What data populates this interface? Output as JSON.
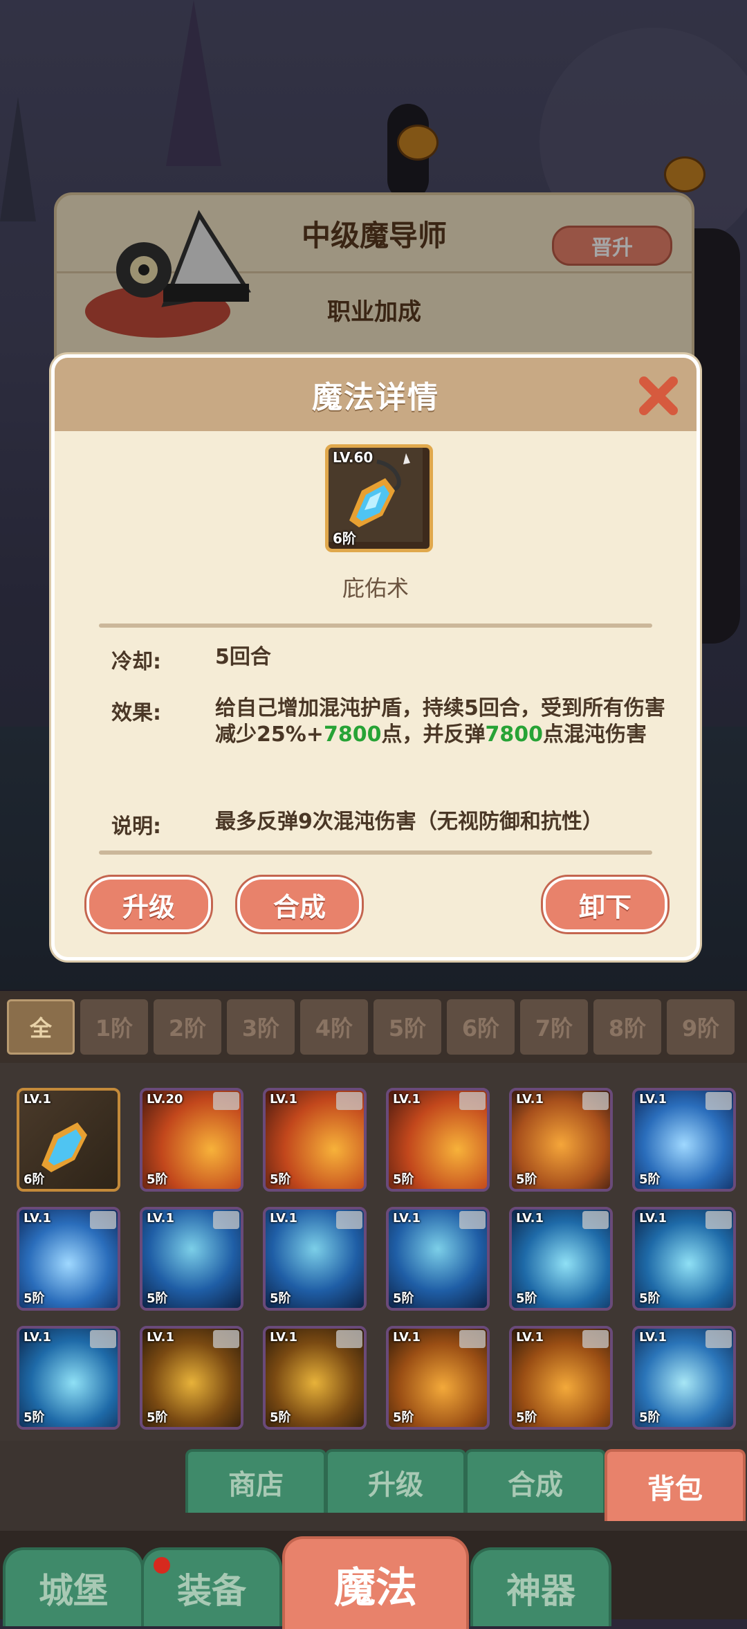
{
  "job_panel": {
    "title": "中级魔导师",
    "promote_label": "晋升",
    "subtitle": "职业加成"
  },
  "modal": {
    "title": "魔法详情",
    "skill": {
      "level": "LV.60",
      "tier": "6阶",
      "name": "庇佑术"
    },
    "cooldown_key": "冷却:",
    "cooldown_value": "5回合",
    "effect_key": "效果:",
    "effect_part1": "给自己增加混沌护盾，持续5回合，受到所有伤害减少25%+",
    "effect_value1": "7800",
    "effect_part2": "点，并反弹",
    "effect_value2": "7800",
    "effect_part3": "点混沌伤害",
    "desc_key": "说明:",
    "desc_value": "最多反弹9次混沌伤害（无视防御和抗性）",
    "buttons": {
      "upgrade": "升级",
      "compose": "合成",
      "unequip": "卸下"
    }
  },
  "tier_filters": [
    "全",
    "1阶",
    "2阶",
    "3阶",
    "4阶",
    "5阶",
    "6阶",
    "7阶",
    "8阶",
    "9阶"
  ],
  "inventory": [
    {
      "level": "LV.1",
      "tier": "6阶",
      "icon": "crystal-amulet"
    },
    {
      "level": "LV.20",
      "tier": "5阶",
      "icon": "fire"
    },
    {
      "level": "LV.1",
      "tier": "5阶",
      "icon": "fire"
    },
    {
      "level": "LV.1",
      "tier": "5阶",
      "icon": "fire"
    },
    {
      "level": "LV.1",
      "tier": "5阶",
      "icon": "shield"
    },
    {
      "level": "LV.1",
      "tier": "5阶",
      "icon": "water"
    },
    {
      "level": "LV.1",
      "tier": "5阶",
      "icon": "water"
    },
    {
      "level": "LV.1",
      "tier": "5阶",
      "icon": "thunder-cloud"
    },
    {
      "level": "LV.1",
      "tier": "5阶",
      "icon": "thunder-cloud"
    },
    {
      "level": "LV.1",
      "tier": "5阶",
      "icon": "thunder-cloud"
    },
    {
      "level": "LV.1",
      "tier": "5阶",
      "icon": "ice"
    },
    {
      "level": "LV.1",
      "tier": "5阶",
      "icon": "ice"
    },
    {
      "level": "LV.1",
      "tier": "5阶",
      "icon": "ice"
    },
    {
      "level": "LV.1",
      "tier": "5阶",
      "icon": "earth"
    },
    {
      "level": "LV.1",
      "tier": "5阶",
      "icon": "earth"
    },
    {
      "level": "LV.1",
      "tier": "5阶",
      "icon": "meteor"
    },
    {
      "level": "LV.1",
      "tier": "5阶",
      "icon": "meteor"
    },
    {
      "level": "LV.1",
      "tier": "5阶",
      "icon": "heal-heart"
    }
  ],
  "sub_tabs": [
    "商店",
    "升级",
    "合成",
    "背包"
  ],
  "bottom_nav": [
    "城堡",
    "装备",
    "魔法",
    "神器"
  ],
  "colors": {
    "accent": "#e8826b",
    "tab_green": "#3f8a6a",
    "highlight_green": "#27a336"
  }
}
